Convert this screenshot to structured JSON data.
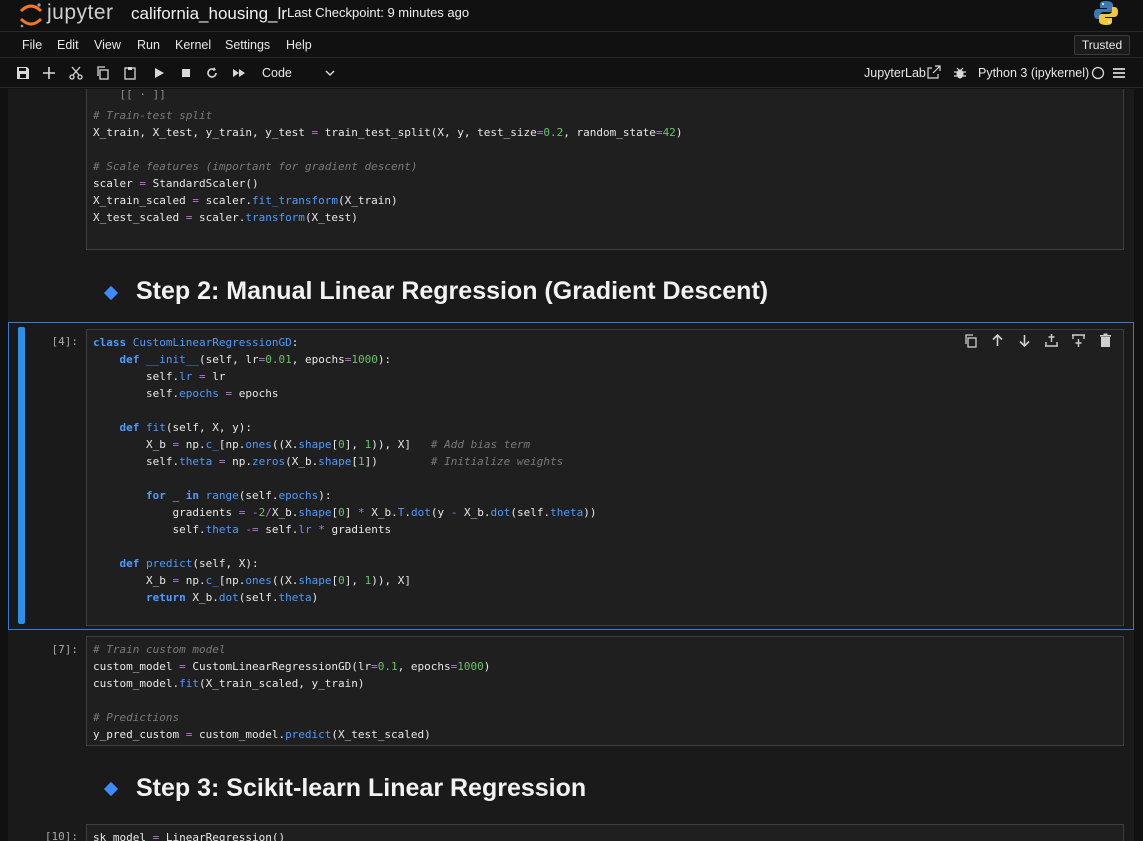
{
  "header": {
    "brand": "jupyter",
    "notebook_title": "california_housing_lr",
    "checkpoint": "Last Checkpoint: 9 minutes ago"
  },
  "menu": {
    "items": [
      "File",
      "Edit",
      "View",
      "Run",
      "Kernel",
      "Settings",
      "Help"
    ],
    "trusted": "Trusted"
  },
  "toolbar": {
    "icons": [
      "save-icon",
      "add-icon",
      "cut-icon",
      "copy-icon",
      "paste-icon",
      "run-icon",
      "stop-icon",
      "restart-icon",
      "fast-forward-icon"
    ],
    "cell_type": "Code",
    "jupyterlab_link": "JupyterLab",
    "kernel": "Python 3 (ipykernel)"
  },
  "cells": {
    "c1": {
      "lines": [
        "# Train-test split",
        "X_train, X_test, y_train, y_test = train_test_split(X, y, test_size=0.2, random_state=42)",
        "",
        "# Scale features (important for gradient descent)",
        "scaler = StandardScaler()",
        "X_train_scaled = scaler.fit_transform(X_train)",
        "X_test_scaled = scaler.transform(X_test)"
      ]
    },
    "md1": {
      "heading": "Step 2: Manual Linear Regression (Gradient Descent)"
    },
    "c2": {
      "prompt": "[4]:",
      "lines": [
        "class CustomLinearRegressionGD:",
        "    def __init__(self, lr=0.01, epochs=1000):",
        "        self.lr = lr",
        "        self.epochs = epochs",
        "",
        "    def fit(self, X, y):",
        "        X_b = np.c_[np.ones((X.shape[0], 1)), X]   # Add bias term",
        "        self.theta = np.zeros(X_b.shape[1])        # Initialize weights",
        "",
        "        for _ in range(self.epochs):",
        "            gradients = -2/X_b.shape[0] * X_b.T.dot(y - X_b.dot(self.theta))",
        "            self.theta -= self.lr * gradients",
        "",
        "    def predict(self, X):",
        "        X_b = np.c_[np.ones((X.shape[0], 1)), X]",
        "        return X_b.dot(self.theta)"
      ]
    },
    "c3": {
      "prompt": "[7]:",
      "lines": [
        "# Train custom model",
        "custom_model = CustomLinearRegressionGD(lr=0.1, epochs=1000)",
        "custom_model.fit(X_train_scaled, y_train)",
        "",
        "# Predictions",
        "y_pred_custom = custom_model.predict(X_test_scaled)"
      ]
    },
    "md2": {
      "heading": "Step 3: Scikit-learn Linear Regression"
    },
    "c4": {
      "prompt": "[10]:",
      "lines": [
        "sk_model = LinearRegression()"
      ]
    }
  },
  "colors": {
    "accent": "#2e8fe6",
    "keyword": "#4e9bff",
    "number": "#6cc36c",
    "operator": "#b07ad6",
    "comment": "#7a7a7a"
  }
}
